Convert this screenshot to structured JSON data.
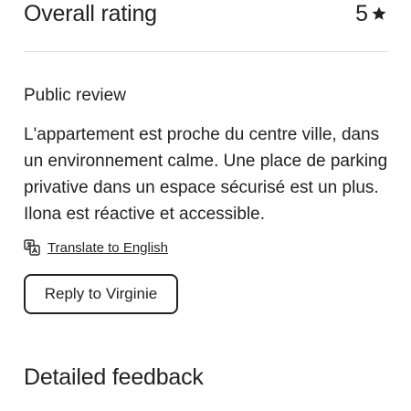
{
  "overall": {
    "title": "Overall rating",
    "value": "5",
    "icon": "star-icon"
  },
  "public_review": {
    "label": "Public review",
    "text": "L'appartement est proche du centre ville, dans un environnement calme. Une place de parking privative dans un espace sécurisé est un plus. Ilona est réactive et accessible."
  },
  "translate": {
    "icon": "translate-icon",
    "label": "Translate to English"
  },
  "reply": {
    "label": "Reply to Virginie"
  },
  "detailed": {
    "title": "Detailed feedback"
  },
  "colors": {
    "text": "#222222",
    "divider": "#dddddd",
    "background": "#ffffff"
  }
}
